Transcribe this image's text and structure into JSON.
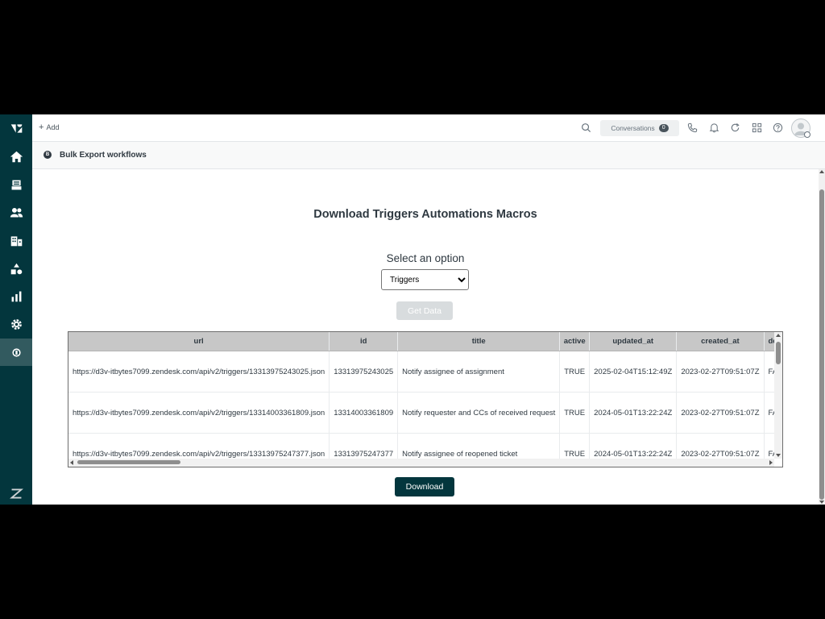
{
  "topbar": {
    "add_label": "Add",
    "conversations_label": "Conversations",
    "conversations_count": "0"
  },
  "sidebar": {
    "items": [
      {
        "name": "zendesk-logo-icon"
      },
      {
        "name": "home-icon"
      },
      {
        "name": "views-icon"
      },
      {
        "name": "customers-icon"
      },
      {
        "name": "organizations-icon"
      },
      {
        "name": "objects-icon"
      },
      {
        "name": "reporting-icon"
      },
      {
        "name": "admin-gear-icon"
      },
      {
        "name": "bulk-export-app-icon",
        "active": true
      },
      {
        "name": "zendesk-products-icon"
      }
    ]
  },
  "app_header": {
    "logo_letter": "B",
    "title": "Bulk Export workflows"
  },
  "main": {
    "title": "Download Triggers Automations Macros",
    "select_label": "Select an option",
    "select_value": "Triggers",
    "get_data_label": "Get Data",
    "download_label": "Download"
  },
  "table": {
    "columns": [
      "url",
      "id",
      "title",
      "active",
      "updated_at",
      "created_at",
      "def"
    ],
    "rows": [
      [
        "https://d3v-itbytes7099.zendesk.com/api/v2/triggers/13313975243025.json",
        "13313975243025",
        "Notify assignee of assignment",
        "TRUE",
        "2025-02-04T15:12:49Z",
        "2023-02-27T09:51:07Z",
        "FAL"
      ],
      [
        "https://d3v-itbytes7099.zendesk.com/api/v2/triggers/13314003361809.json",
        "13314003361809",
        "Notify requester and CCs of received request",
        "TRUE",
        "2024-05-01T13:22:24Z",
        "2023-02-27T09:51:07Z",
        "FAL"
      ],
      [
        "https://d3v-itbytes7099.zendesk.com/api/v2/triggers/13313975247377.json",
        "13313975247377",
        "Notify assignee of reopened ticket",
        "TRUE",
        "2024-05-01T13:22:24Z",
        "2023-02-27T09:51:07Z",
        "FAL"
      ]
    ]
  },
  "colors": {
    "sidebar_bg": "#03363d",
    "primary_button": "#03363d",
    "disabled_button": "#d8dcde",
    "table_header": "#c7c7c7"
  }
}
